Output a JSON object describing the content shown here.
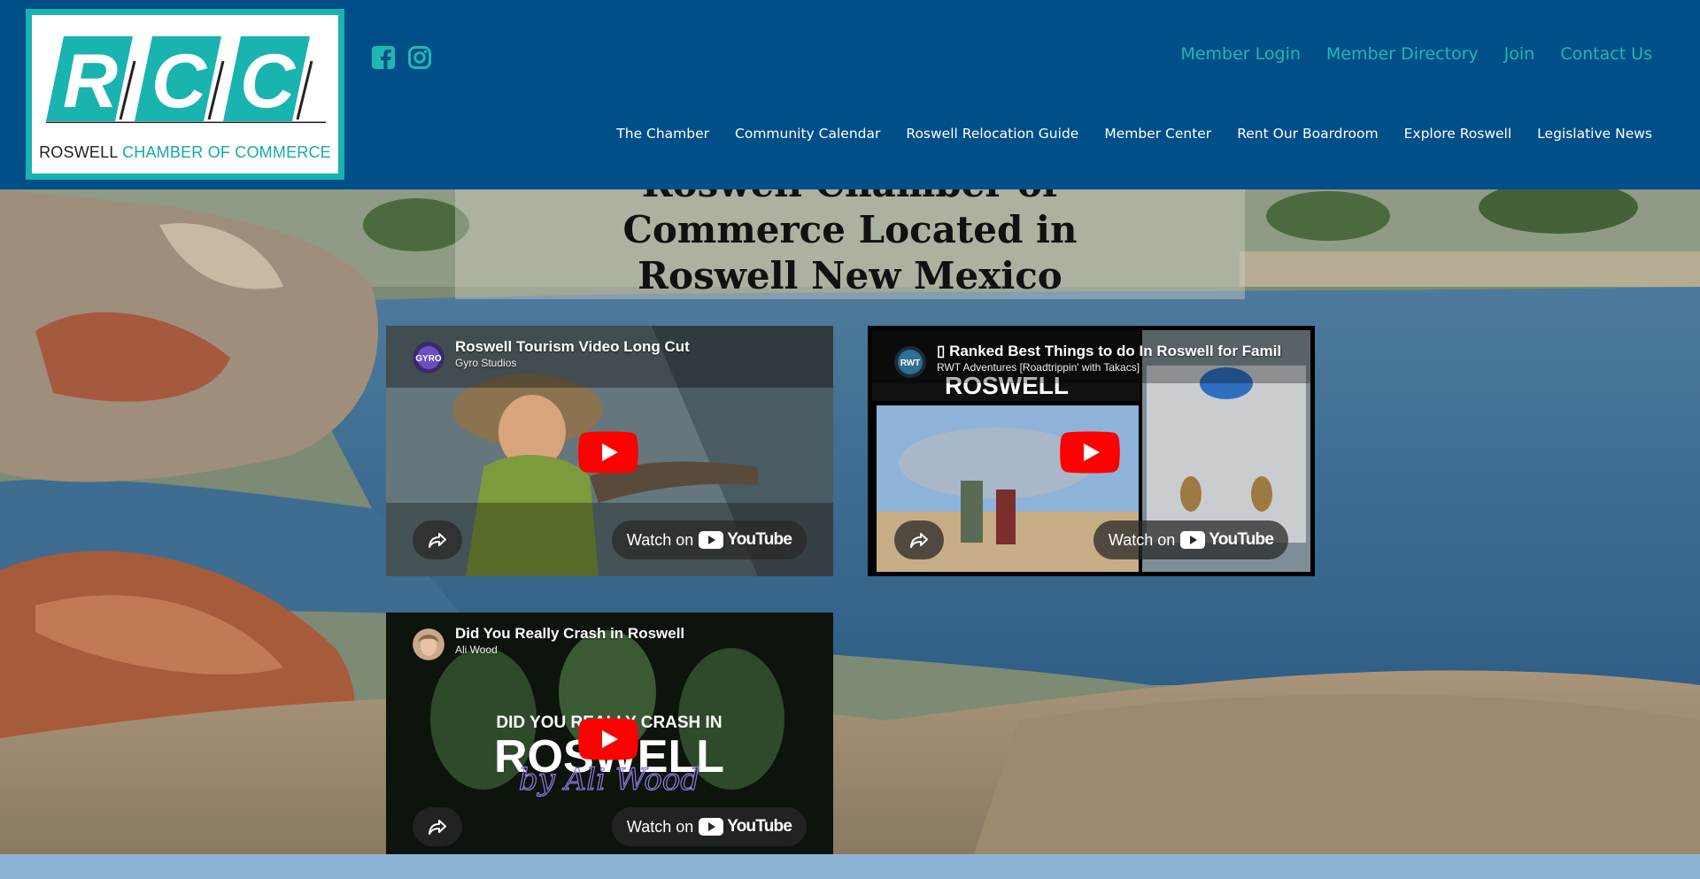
{
  "header": {
    "logo": {
      "letters": [
        "R",
        "C",
        "C"
      ],
      "name_dark": "ROSWELL",
      "name_teal": "CHAMBER OF COMMERCE"
    },
    "social": [
      {
        "name": "facebook-icon"
      },
      {
        "name": "instagram-icon"
      }
    ],
    "top_nav": [
      "Member Login",
      "Member Directory",
      "Join",
      "Contact Us"
    ],
    "main_nav": [
      "The Chamber",
      "Community Calendar",
      "Roswell Relocation Guide",
      "Member Center",
      "Rent Our Boardroom",
      "Explore Roswell",
      "Legislative News"
    ]
  },
  "hero": {
    "title_line1": "Roswell Chamber of",
    "title_line2": "Commerce Located in",
    "title_line3": "Roswell New Mexico"
  },
  "videos": [
    {
      "title": "Roswell Tourism Video Long Cut",
      "channel": "Gyro Studios",
      "avatar_text": "GYRO",
      "watch_label": "Watch on",
      "yt_word": "YouTube"
    },
    {
      "title": "▯ Ranked Best Things to do In Roswell for Famili",
      "channel": "RWT Adventures [Roadtrippin' with Takacs]",
      "avatar_text": "RWT",
      "thumb_text": "ROSWELL",
      "watch_label": "Watch on",
      "yt_word": "YouTube"
    },
    {
      "title": "Did You Really Crash in Roswell",
      "channel": "Ali Wood",
      "thumb_text_1": "DID YOU REALLY CRASH IN",
      "thumb_text_2": "ROSWELL",
      "thumb_text_3": "by Ali Wood",
      "watch_label": "Watch on",
      "yt_word": "YouTube"
    }
  ],
  "colors": {
    "header_bg": "#004f88",
    "teal": "#1fb8b5",
    "footer_band": "#8db3d4",
    "youtube_red": "#ff0000"
  }
}
